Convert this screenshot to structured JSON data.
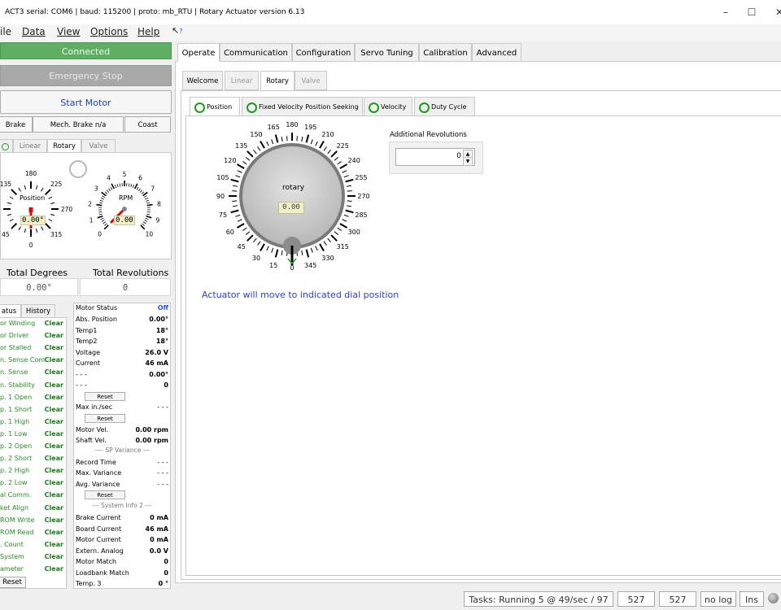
{
  "title_bar": {
    "title": "ACT3  serial: COM6  |  baud: 115200  |  proto: mb_RTU  |  Rotary Actuator version 6.13",
    "minimize": "–",
    "maximize": "☐",
    "close": "✕"
  },
  "menu": {
    "file": "ile",
    "data": "Data",
    "view": "View",
    "options": "Options",
    "help": "Help"
  },
  "left": {
    "connected_label": "Connected",
    "estop_label": "Emergency Stop",
    "start_label": "Start Motor",
    "brake_label": "Brake",
    "mech_brake_label": "Mech. Brake n/a",
    "coast_label": "Coast",
    "tabs": [
      "Linear",
      "Rotary",
      "Valve"
    ],
    "position_gauge": {
      "label": "Position",
      "value_text": "0.00°",
      "ticks": [
        "180",
        "225",
        "270",
        "315",
        "0",
        "45",
        "135"
      ]
    },
    "rpm_gauge": {
      "label": "RPM",
      "value_text": "0.00",
      "ticks": [
        "0",
        "1",
        "2",
        "3",
        "4",
        "5",
        "6",
        "7",
        "8",
        "9",
        "10"
      ]
    },
    "total_degrees_label": "Total Degrees",
    "total_degrees_value": "0.00°",
    "total_revolutions_label": "Total Revolutions",
    "total_revolutions_value": "0",
    "status_tabs": [
      "atus",
      "History"
    ],
    "status_rows": [
      {
        "name": "or Winding",
        "value": "Clear"
      },
      {
        "name": "or Driver",
        "value": "Clear"
      },
      {
        "name": "or Stalled",
        "value": "Clear"
      },
      {
        "name": "n. Sense Com",
        "value": "Clear"
      },
      {
        "name": "n. Sense",
        "value": "Clear"
      },
      {
        "name": "n. Stability",
        "value": "Clear"
      },
      {
        "name": "p. 1 Open",
        "value": "Clear"
      },
      {
        "name": "p. 1 Short",
        "value": "Clear"
      },
      {
        "name": "p. 1 High",
        "value": "Clear"
      },
      {
        "name": "p. 1 Low",
        "value": "Clear"
      },
      {
        "name": "p. 2 Open",
        "value": "Clear"
      },
      {
        "name": "p. 2 Short",
        "value": "Clear"
      },
      {
        "name": "p. 2 High",
        "value": "Clear"
      },
      {
        "name": "p. 2 Low",
        "value": "Clear"
      },
      {
        "name": "al Comm.",
        "value": "Clear"
      },
      {
        "name": "ket Align",
        "value": "Clear"
      },
      {
        "name": "ROM Write",
        "value": "Clear"
      },
      {
        "name": "ROM Read",
        "value": "Clear"
      },
      {
        "name": ". Count",
        "value": "Clear"
      },
      {
        "name": "System",
        "value": "Clear"
      },
      {
        "name": "ameter",
        "value": "Clear"
      }
    ],
    "reset_label": "Reset",
    "motor_status": {
      "header_name": "Motor Status",
      "header_value": "Off",
      "rows_a": [
        {
          "name": "Abs. Position",
          "value": "0.00°"
        },
        {
          "name": "Temp1",
          "value": "18°"
        },
        {
          "name": "Temp2",
          "value": "18°"
        },
        {
          "name": "Voltage",
          "value": "26.0 V"
        },
        {
          "name": "Current",
          "value": "46 mA"
        },
        {
          "name": "- - -",
          "value": "0.00°"
        },
        {
          "name": "- - -",
          "value": "0"
        }
      ],
      "reset1": "Reset",
      "max_in_sec_name": "Max in./sec",
      "max_in_sec_value": "- - -",
      "reset2": "Reset",
      "motor_vel_name": "Motor Vel.",
      "motor_vel_value": "0.00 rpm",
      "shaft_vel_name": "Shaft Vel.",
      "shaft_vel_value": "0.00 rpm",
      "sp_variance_label": "---- SP Variance ---",
      "record_time_name": "Record Time",
      "record_time_value": "- - -",
      "max_var_name": "Max. Variance",
      "max_var_value": "- - -",
      "avg_var_name": "Avg. Variance",
      "avg_var_value": "- - -",
      "reset3": "Reset",
      "system_info_label": "--- System Info 2 ---",
      "rows_b": [
        {
          "name": "Brake Current",
          "value": "0 mA"
        },
        {
          "name": "Board Current",
          "value": "46 mA"
        },
        {
          "name": "Motor Current",
          "value": "0 mA"
        },
        {
          "name": "Extern. Analog",
          "value": "0.0 V"
        },
        {
          "name": "Motor Match",
          "value": "0"
        },
        {
          "name": "Loadbank Match",
          "value": "0"
        },
        {
          "name": "Temp. 3",
          "value": "0 °"
        }
      ]
    }
  },
  "top_tabs": [
    "Operate",
    "Communication",
    "Configuration",
    "Servo Tuning",
    "Calibration",
    "Advanced"
  ],
  "sub_tabs": [
    "Welcome",
    "Linear",
    "Rotary",
    "Valve"
  ],
  "mode_tabs": [
    "Position",
    "Fixed Velocity Position Seeking",
    "Velocity",
    "Duty Cycle"
  ],
  "dial": {
    "center_label": "rotary",
    "value_text": "0.00",
    "tick_labels": [
      "0",
      "15",
      "30",
      "45",
      "60",
      "75",
      "90",
      "105",
      "120",
      "135",
      "150",
      "165",
      "180",
      "195",
      "210",
      "225",
      "240",
      "255",
      "270",
      "285",
      "300",
      "315",
      "330",
      "345"
    ]
  },
  "additional_revolutions": {
    "label": "Additional Revolutions",
    "value": "0"
  },
  "info_message": "Actuator will move to indicated dial position",
  "status_bar": {
    "tasks": "Tasks: Running 5 @ 49/sec / 97",
    "count1": "527",
    "count2": "527",
    "log": "no log",
    "ins": "Ins"
  },
  "colors": {
    "connected": "#5fae64",
    "start_text": "#1e3fbf",
    "clear_green": "#1a7a1a",
    "off_blue": "#1e5bd8",
    "info_blue": "#2a3fd0",
    "radio_green": "#1f9a1f"
  }
}
